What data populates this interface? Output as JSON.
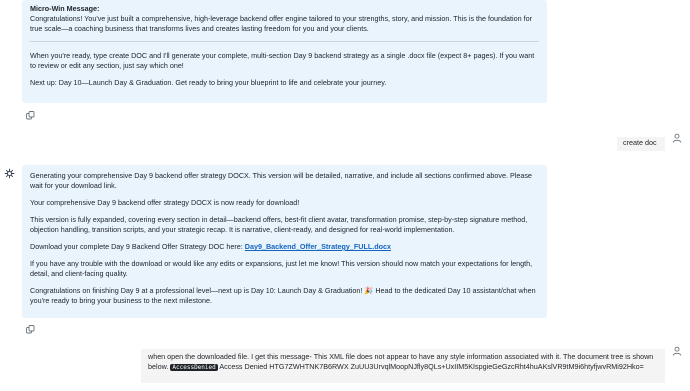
{
  "bubble1": {
    "heading": "Micro-Win Message:",
    "congrats": "Congratulations! You've just built a comprehensive, high-leverage backend offer engine tailored to your strengths, story, and mission. This is the foundation for true scale—a coaching business that transforms lives and creates lasting freedom for you and your clients.",
    "instructions": "When you're ready, type create DOC and I'll generate your complete, multi-section Day 9 backend strategy as a single .docx file (expect 8+ pages). If you want to review or edit any section, just say which one!",
    "next_up": "Next up: Day 10—Launch Day & Graduation. Get ready to bring your blueprint to life and celebrate your journey."
  },
  "user_msg1": {
    "text": "create doc"
  },
  "bubble2": {
    "p1": "Generating your comprehensive Day 9 backend offer strategy DOCX. This version will be detailed, narrative, and include all sections confirmed above. Please wait for your download link.",
    "p2": "Your comprehensive Day 9 backend offer strategy DOCX is now ready for download!",
    "p3": "This version is fully expanded, covering every section in detail—backend offers, best-fit client avatar, transformation promise, step-by-step signature method, objection handling, transition scripts, and your strategic recap. It is narrative, client-ready, and designed for real-world implementation.",
    "p4_prefix": "Download your complete Day 9 Backend Offer Strategy DOC here: ",
    "p4_link": "Day9_Backend_Offer_Strategy_FULL.docx",
    "p5": "If you have any trouble with the download or would like any edits or expansions, just let me know! This version should now match your expectations for length, detail, and client-facing quality.",
    "p6": "Congratulations on finishing Day 9 at a professional level—next up is Day 10: Launch Day & Graduation! 🎉  Head to the dedicated Day 10 assistant/chat when you're ready to bring your business to the next milestone."
  },
  "user_msg2": {
    "text_prefix": "when open the downloaded file. I get this message- This XML file does not appear to have any style information associated with it. The document tree is shown below.",
    "badge": "AccessDenied",
    "text_suffix": "Access Denied HTG7ZWHTNK7B6RWX ZuUU3UrvqlMoopNJfly8QLs+UxIIM5KIspgieGeGzcRht4huAKslVR9tM9i6htyfjwvRMi92Hko="
  },
  "icons": {
    "copy": "copy-icon",
    "user": "user-avatar-icon",
    "assistant": "assistant-logo-icon"
  }
}
